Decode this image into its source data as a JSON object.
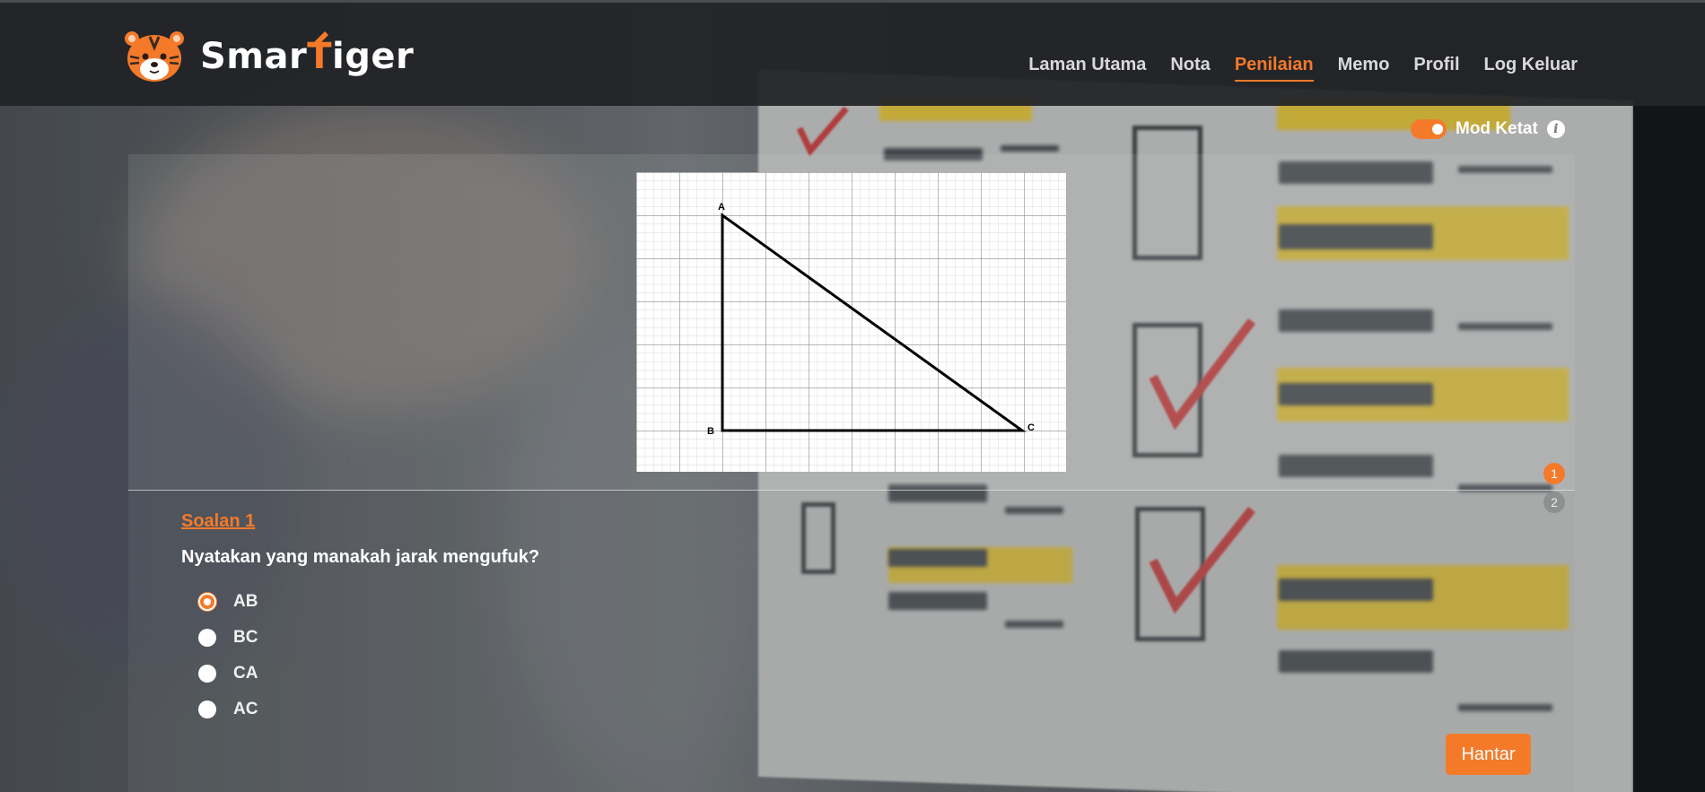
{
  "brand": {
    "name_part1": "Smar",
    "name_part2": "T",
    "name_part3": "iger",
    "accent_color": "#f47a2a"
  },
  "nav": {
    "items": [
      {
        "label": "Laman Utama",
        "active": false
      },
      {
        "label": "Nota",
        "active": false
      },
      {
        "label": "Penilaian",
        "active": true
      },
      {
        "label": "Memo",
        "active": false
      },
      {
        "label": "Profil",
        "active": false
      },
      {
        "label": "Log Keluar",
        "active": false
      }
    ]
  },
  "strict_mode": {
    "label": "Mod Ketat",
    "enabled": true,
    "info_icon": "i"
  },
  "diagram": {
    "vertices": {
      "a": "A",
      "b": "B",
      "c": "C"
    }
  },
  "pagination": {
    "pages": [
      "1",
      "2"
    ],
    "current": "1"
  },
  "question": {
    "number_label": "Soalan 1",
    "text": "Nyatakan yang manakah jarak mengufuk?",
    "options": [
      {
        "label": "AB",
        "selected": true
      },
      {
        "label": "BC",
        "selected": false
      },
      {
        "label": "CA",
        "selected": false
      },
      {
        "label": "AC",
        "selected": false
      }
    ]
  },
  "submit_label": "Hantar"
}
